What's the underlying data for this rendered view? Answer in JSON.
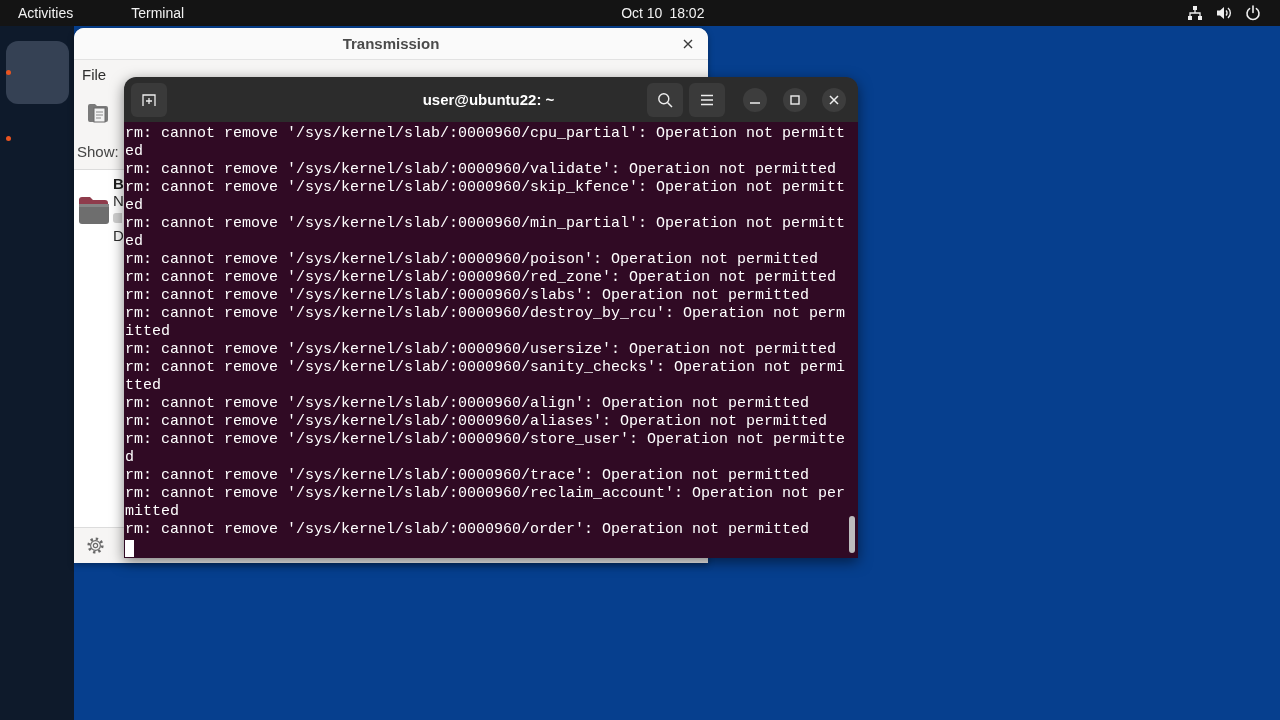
{
  "top_bar": {
    "activities": "Activities",
    "app_menu": "Terminal",
    "date": "Oct 10",
    "time": "18:02"
  },
  "dock": {
    "items": [
      {
        "selected": true
      },
      {
        "selected": false
      }
    ]
  },
  "transmission": {
    "title": "Transmission",
    "menu": [
      "File"
    ],
    "filter_label": "Show:",
    "torrents": [
      {
        "name": "B",
        "line_2": "N",
        "line_3": "D"
      }
    ]
  },
  "terminal": {
    "title": "user@ubuntu22: ~",
    "lines": [
      "rm: cannot remove '/sys/kernel/slab/:0000960/cpu_partial': Operation not permitted",
      "rm: cannot remove '/sys/kernel/slab/:0000960/validate': Operation not permitted",
      "rm: cannot remove '/sys/kernel/slab/:0000960/skip_kfence': Operation not permitted",
      "rm: cannot remove '/sys/kernel/slab/:0000960/min_partial': Operation not permitted",
      "rm: cannot remove '/sys/kernel/slab/:0000960/poison': Operation not permitted",
      "rm: cannot remove '/sys/kernel/slab/:0000960/red_zone': Operation not permitted",
      "rm: cannot remove '/sys/kernel/slab/:0000960/slabs': Operation not permitted",
      "rm: cannot remove '/sys/kernel/slab/:0000960/destroy_by_rcu': Operation not permitted",
      "rm: cannot remove '/sys/kernel/slab/:0000960/usersize': Operation not permitted",
      "rm: cannot remove '/sys/kernel/slab/:0000960/sanity_checks': Operation not permitted",
      "rm: cannot remove '/sys/kernel/slab/:0000960/align': Operation not permitted",
      "rm: cannot remove '/sys/kernel/slab/:0000960/aliases': Operation not permitted",
      "rm: cannot remove '/sys/kernel/slab/:0000960/store_user': Operation not permitted",
      "rm: cannot remove '/sys/kernel/slab/:0000960/trace': Operation not permitted",
      "rm: cannot remove '/sys/kernel/slab/:0000960/reclaim_account': Operation not permitted",
      "rm: cannot remove '/sys/kernel/slab/:0000960/order': Operation not permitted"
    ],
    "cursor": true
  }
}
